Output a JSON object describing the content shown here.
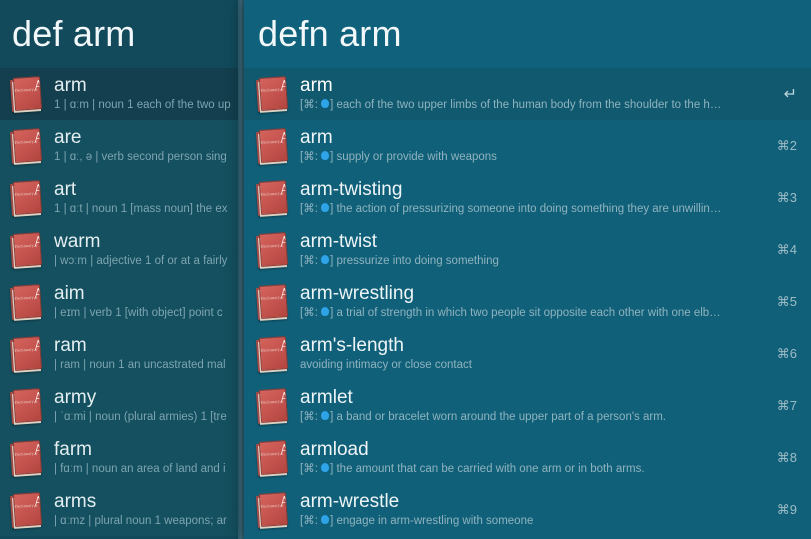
{
  "colors": {
    "left_panel_bg": "#14505f",
    "left_panel_selected": "#133f4e",
    "right_panel_bg": "#116079",
    "right_panel_selected": "#10596f",
    "header_left_bg": "#124a5c",
    "header_right_bg": "#10627c",
    "title_text": "#eef5f7",
    "subtitle_text": "#8fb3bf",
    "accent_blue": "#2ea3e8",
    "book_red": "#c4534e"
  },
  "left_panel": {
    "query": "def arm",
    "icon": "dictionary-book-icon",
    "results": [
      {
        "title": "arm",
        "subtitle": "1 | ɑːm | noun 1 each of the two up",
        "selected": true
      },
      {
        "title": "are",
        "subtitle": "1 | ɑː, ə | verb second person sing",
        "selected": false
      },
      {
        "title": "art",
        "subtitle": "1 | ɑːt | noun 1 [mass noun] the ex",
        "selected": false
      },
      {
        "title": "warm",
        "subtitle": "| wɔːm | adjective 1 of or at a fairly",
        "selected": false
      },
      {
        "title": "aim",
        "subtitle": "| eɪm | verb 1 [with object] point c",
        "selected": false
      },
      {
        "title": "ram",
        "subtitle": "| ram | noun 1 an uncastrated mal",
        "selected": false
      },
      {
        "title": "army",
        "subtitle": "| ˈɑːmi | noun (plural armies) 1 [tre",
        "selected": false
      },
      {
        "title": "farm",
        "subtitle": "| fɑːm | noun an area of land and i",
        "selected": false
      },
      {
        "title": "arms",
        "subtitle": "| ɑːmz | plural noun 1 weapons; ar",
        "selected": false
      }
    ]
  },
  "right_panel": {
    "query": "defn arm",
    "icon": "dictionary-book-icon",
    "subtitle_prefix": "[⌘: ",
    "subtitle_prefix_end": "]",
    "results": [
      {
        "title": "arm",
        "has_prefix": true,
        "subtitle": "each of the two upper limbs of the human body from the shoulder to the h…",
        "shortcut": "↵",
        "shortcut_type": "return",
        "selected": true
      },
      {
        "title": "arm",
        "has_prefix": true,
        "subtitle": "supply or provide with weapons",
        "shortcut": "⌘2",
        "shortcut_type": "command",
        "selected": false
      },
      {
        "title": "arm-twisting",
        "has_prefix": true,
        "subtitle": "the action of pressurizing someone into doing something they are unwillin…",
        "shortcut": "⌘3",
        "shortcut_type": "command",
        "selected": false
      },
      {
        "title": "arm-twist",
        "has_prefix": true,
        "subtitle": "pressurize into doing something",
        "shortcut": "⌘4",
        "shortcut_type": "command",
        "selected": false
      },
      {
        "title": "arm-wrestling",
        "has_prefix": true,
        "subtitle": "a trial of strength in which two people sit opposite each other with one elb…",
        "shortcut": "⌘5",
        "shortcut_type": "command",
        "selected": false
      },
      {
        "title": "arm's-length",
        "has_prefix": false,
        "subtitle": "avoiding intimacy or close contact",
        "shortcut": "⌘6",
        "shortcut_type": "command",
        "selected": false
      },
      {
        "title": "armlet",
        "has_prefix": true,
        "subtitle": "a band or bracelet worn around the upper part of a person's arm.",
        "shortcut": "⌘7",
        "shortcut_type": "command",
        "selected": false
      },
      {
        "title": "armload",
        "has_prefix": true,
        "subtitle": "the amount that can be carried with one arm or in both arms.",
        "shortcut": "⌘8",
        "shortcut_type": "command",
        "selected": false
      },
      {
        "title": "arm-wrestle",
        "has_prefix": true,
        "subtitle": "engage in arm-wrestling with someone",
        "shortcut": "⌘9",
        "shortcut_type": "command",
        "selected": false
      }
    ]
  }
}
